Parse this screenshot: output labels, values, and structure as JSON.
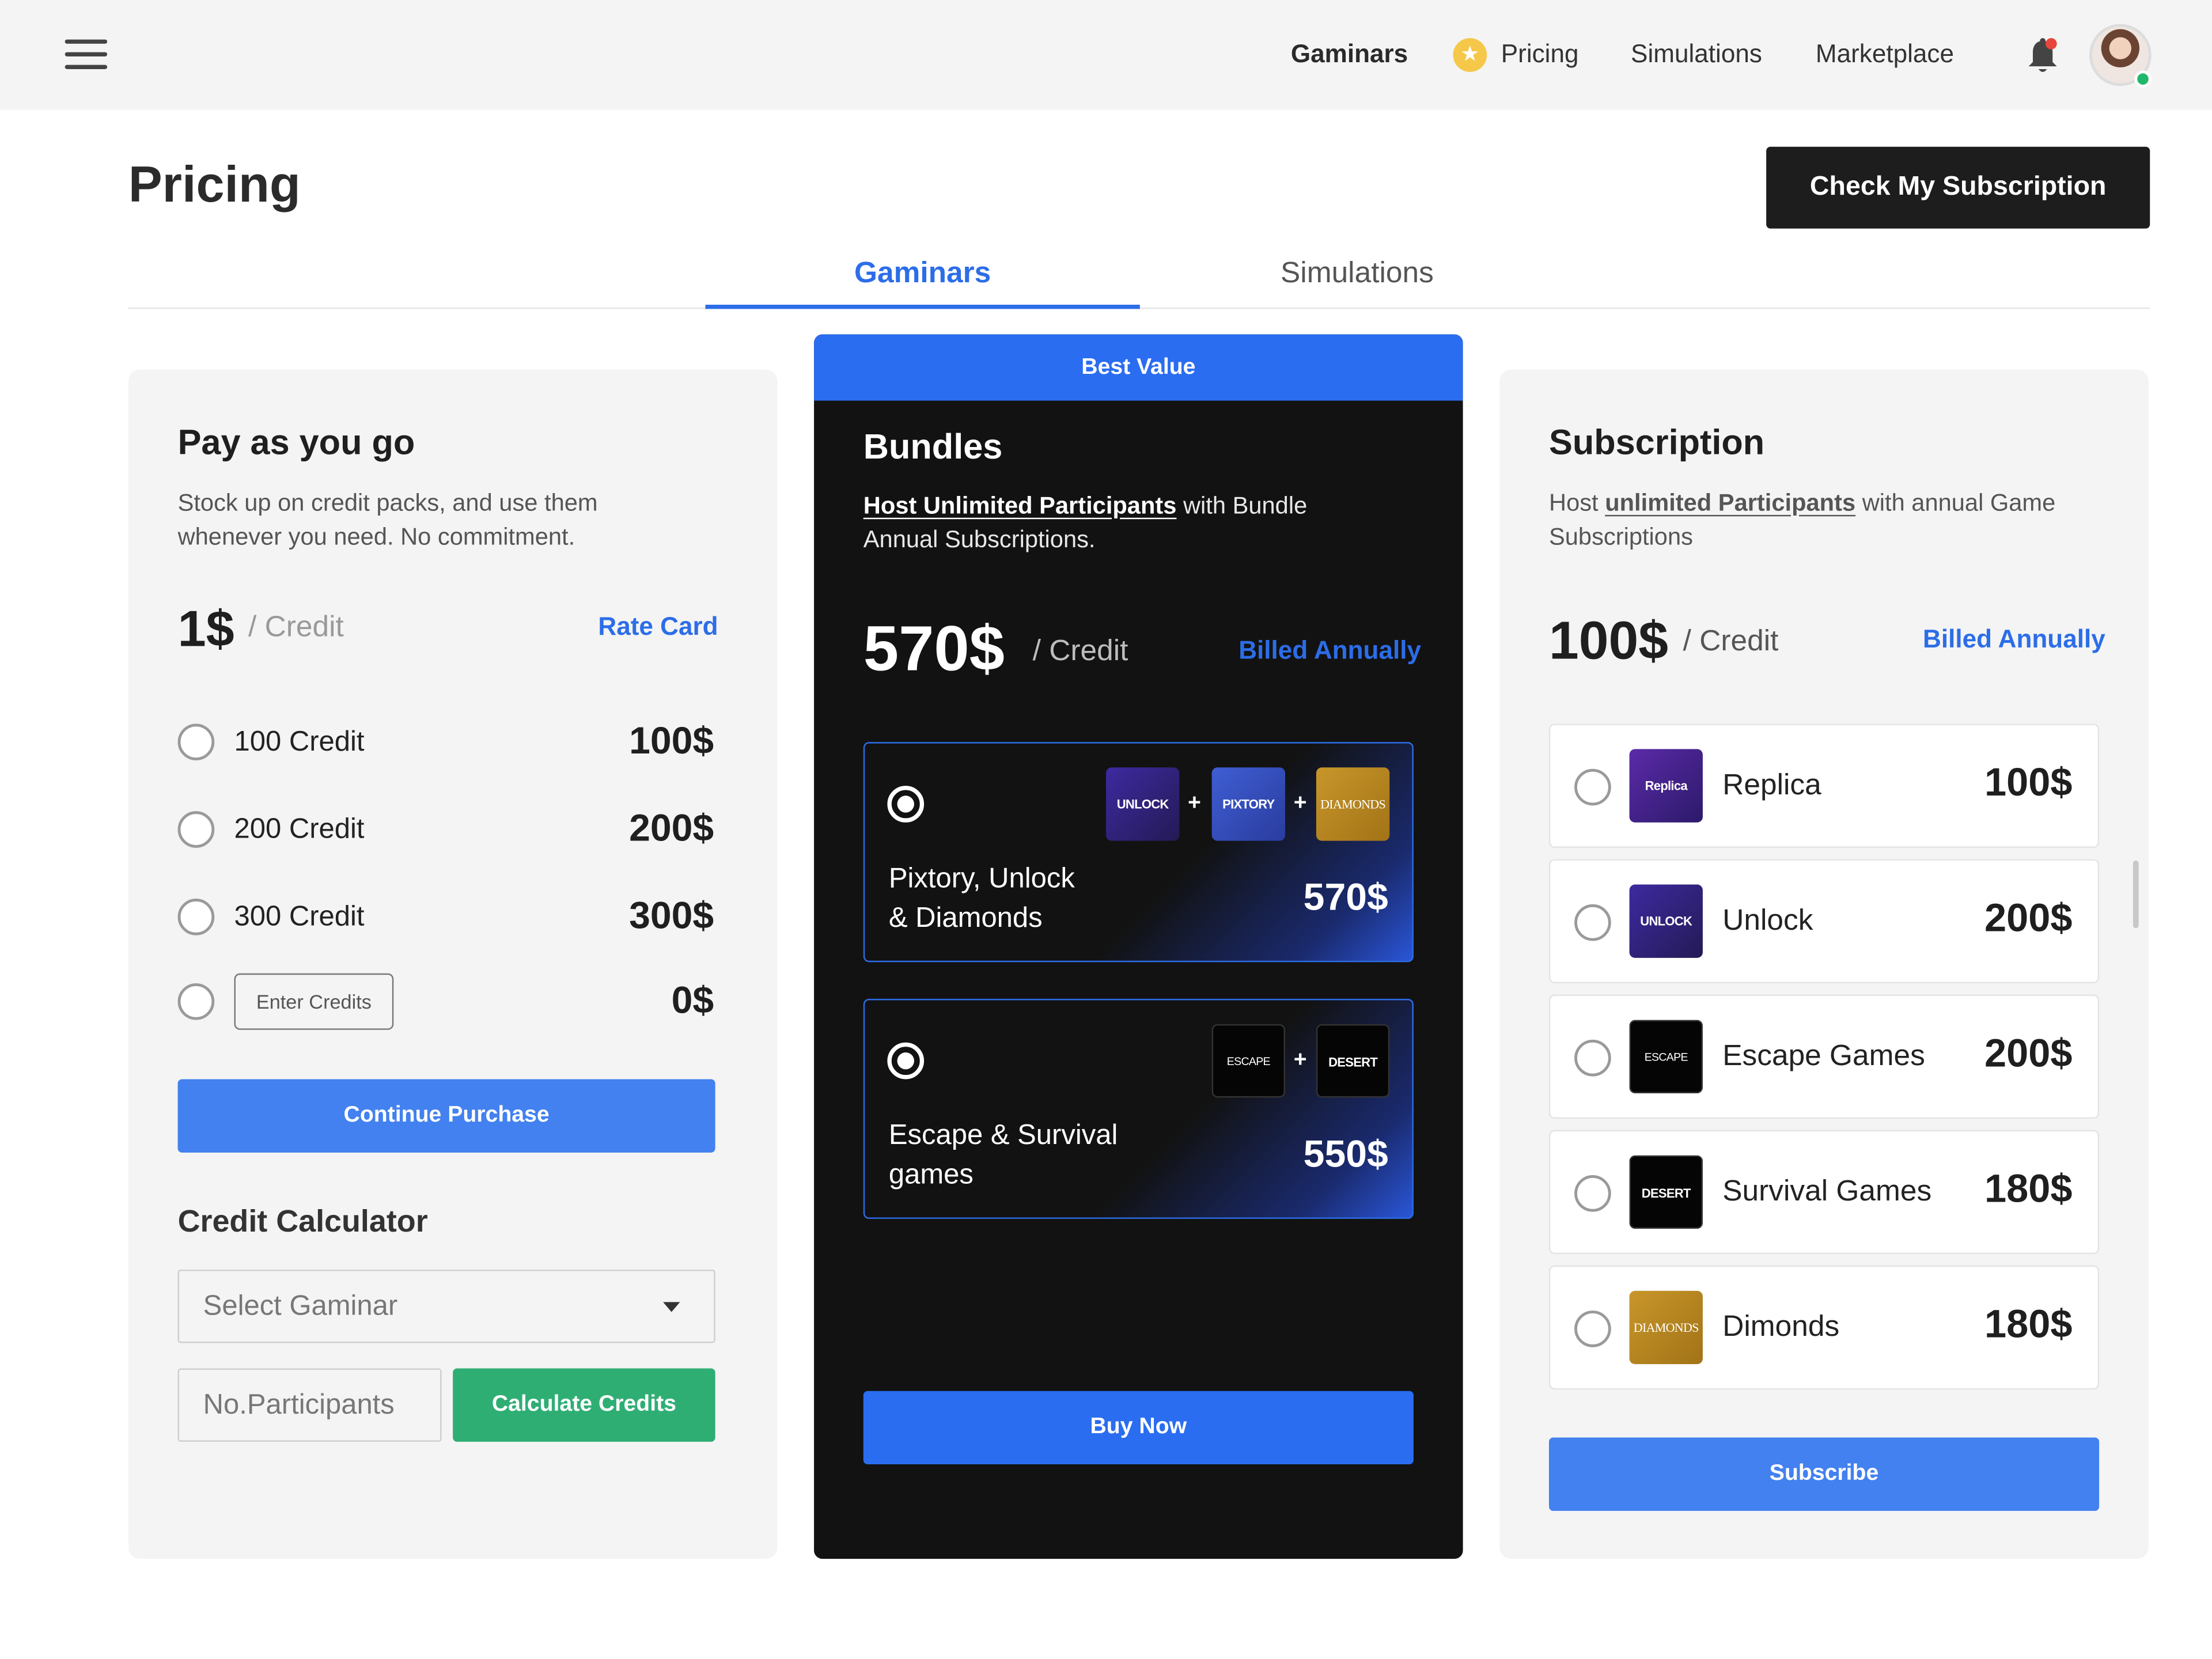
{
  "nav": {
    "links": [
      "Gaminars",
      "Pricing",
      "Simulations",
      "Marketplace"
    ]
  },
  "page": {
    "title": "Pricing",
    "check_subscription": "Check My Subscription",
    "tabs": [
      "Gaminars",
      "Simulations"
    ],
    "active_tab": "Gaminars"
  },
  "payg": {
    "title": "Pay as you go",
    "desc": "Stock up on credit packs, and use them whenever you need. No commitment.",
    "price": "1$",
    "unit": "/ Credit",
    "rate_card": "Rate Card",
    "options": [
      {
        "label": "100 Credit",
        "price": "100$"
      },
      {
        "label": "200 Credit",
        "price": "200$"
      },
      {
        "label": "300 Credit",
        "price": "300$"
      }
    ],
    "custom_placeholder": "Enter Credits",
    "custom_price": "0$",
    "continue": "Continue Purchase",
    "calc_title": "Credit Calculator",
    "select_placeholder": "Select Gaminar",
    "participants_placeholder": "No.Participants",
    "calculate": "Calculate Credits"
  },
  "bundles": {
    "badge": "Best Value",
    "title": "Bundles",
    "desc_link": "Host Unlimited Participants",
    "desc_rest": " with Bundle Annual Subscriptions.",
    "price": "570$",
    "unit": "/ Credit",
    "billing": "Billed Annually",
    "items": [
      {
        "name_line1": "Pixtory, Unlock",
        "name_line2": "& Diamonds",
        "price": "570$",
        "logos": [
          "UNLOCK",
          "PIXTORY",
          "DIAMONDS"
        ]
      },
      {
        "name_line1": "Escape & Survival",
        "name_line2": "games",
        "price": "550$",
        "logos": [
          "ESCAPE GAMES",
          "DESERT"
        ]
      }
    ],
    "buy": "Buy Now"
  },
  "subscription": {
    "title": "Subscription",
    "desc_pre": "Host ",
    "desc_link": "unlimited Participants",
    "desc_rest": " with annual Game Subscriptions",
    "price": "100$",
    "unit": "/ Credit",
    "billing": "Billed Annually",
    "items": [
      {
        "name": "Replica",
        "price": "100$",
        "logo": "Replica"
      },
      {
        "name": "Unlock",
        "price": "200$",
        "logo": "UNLOCK"
      },
      {
        "name": "Escape Games",
        "price": "200$",
        "logo": "ESCAPE GAMES"
      },
      {
        "name": "Survival Games",
        "price": "180$",
        "logo": "DESERT"
      },
      {
        "name": "Dimonds",
        "price": "180$",
        "logo": "DIAMONDS"
      }
    ],
    "subscribe": "Subscribe"
  },
  "colors": {
    "accent": "#2c6de8",
    "button_blue": "#4281ef",
    "button_green": "#2fae74",
    "dark": "#121212"
  }
}
